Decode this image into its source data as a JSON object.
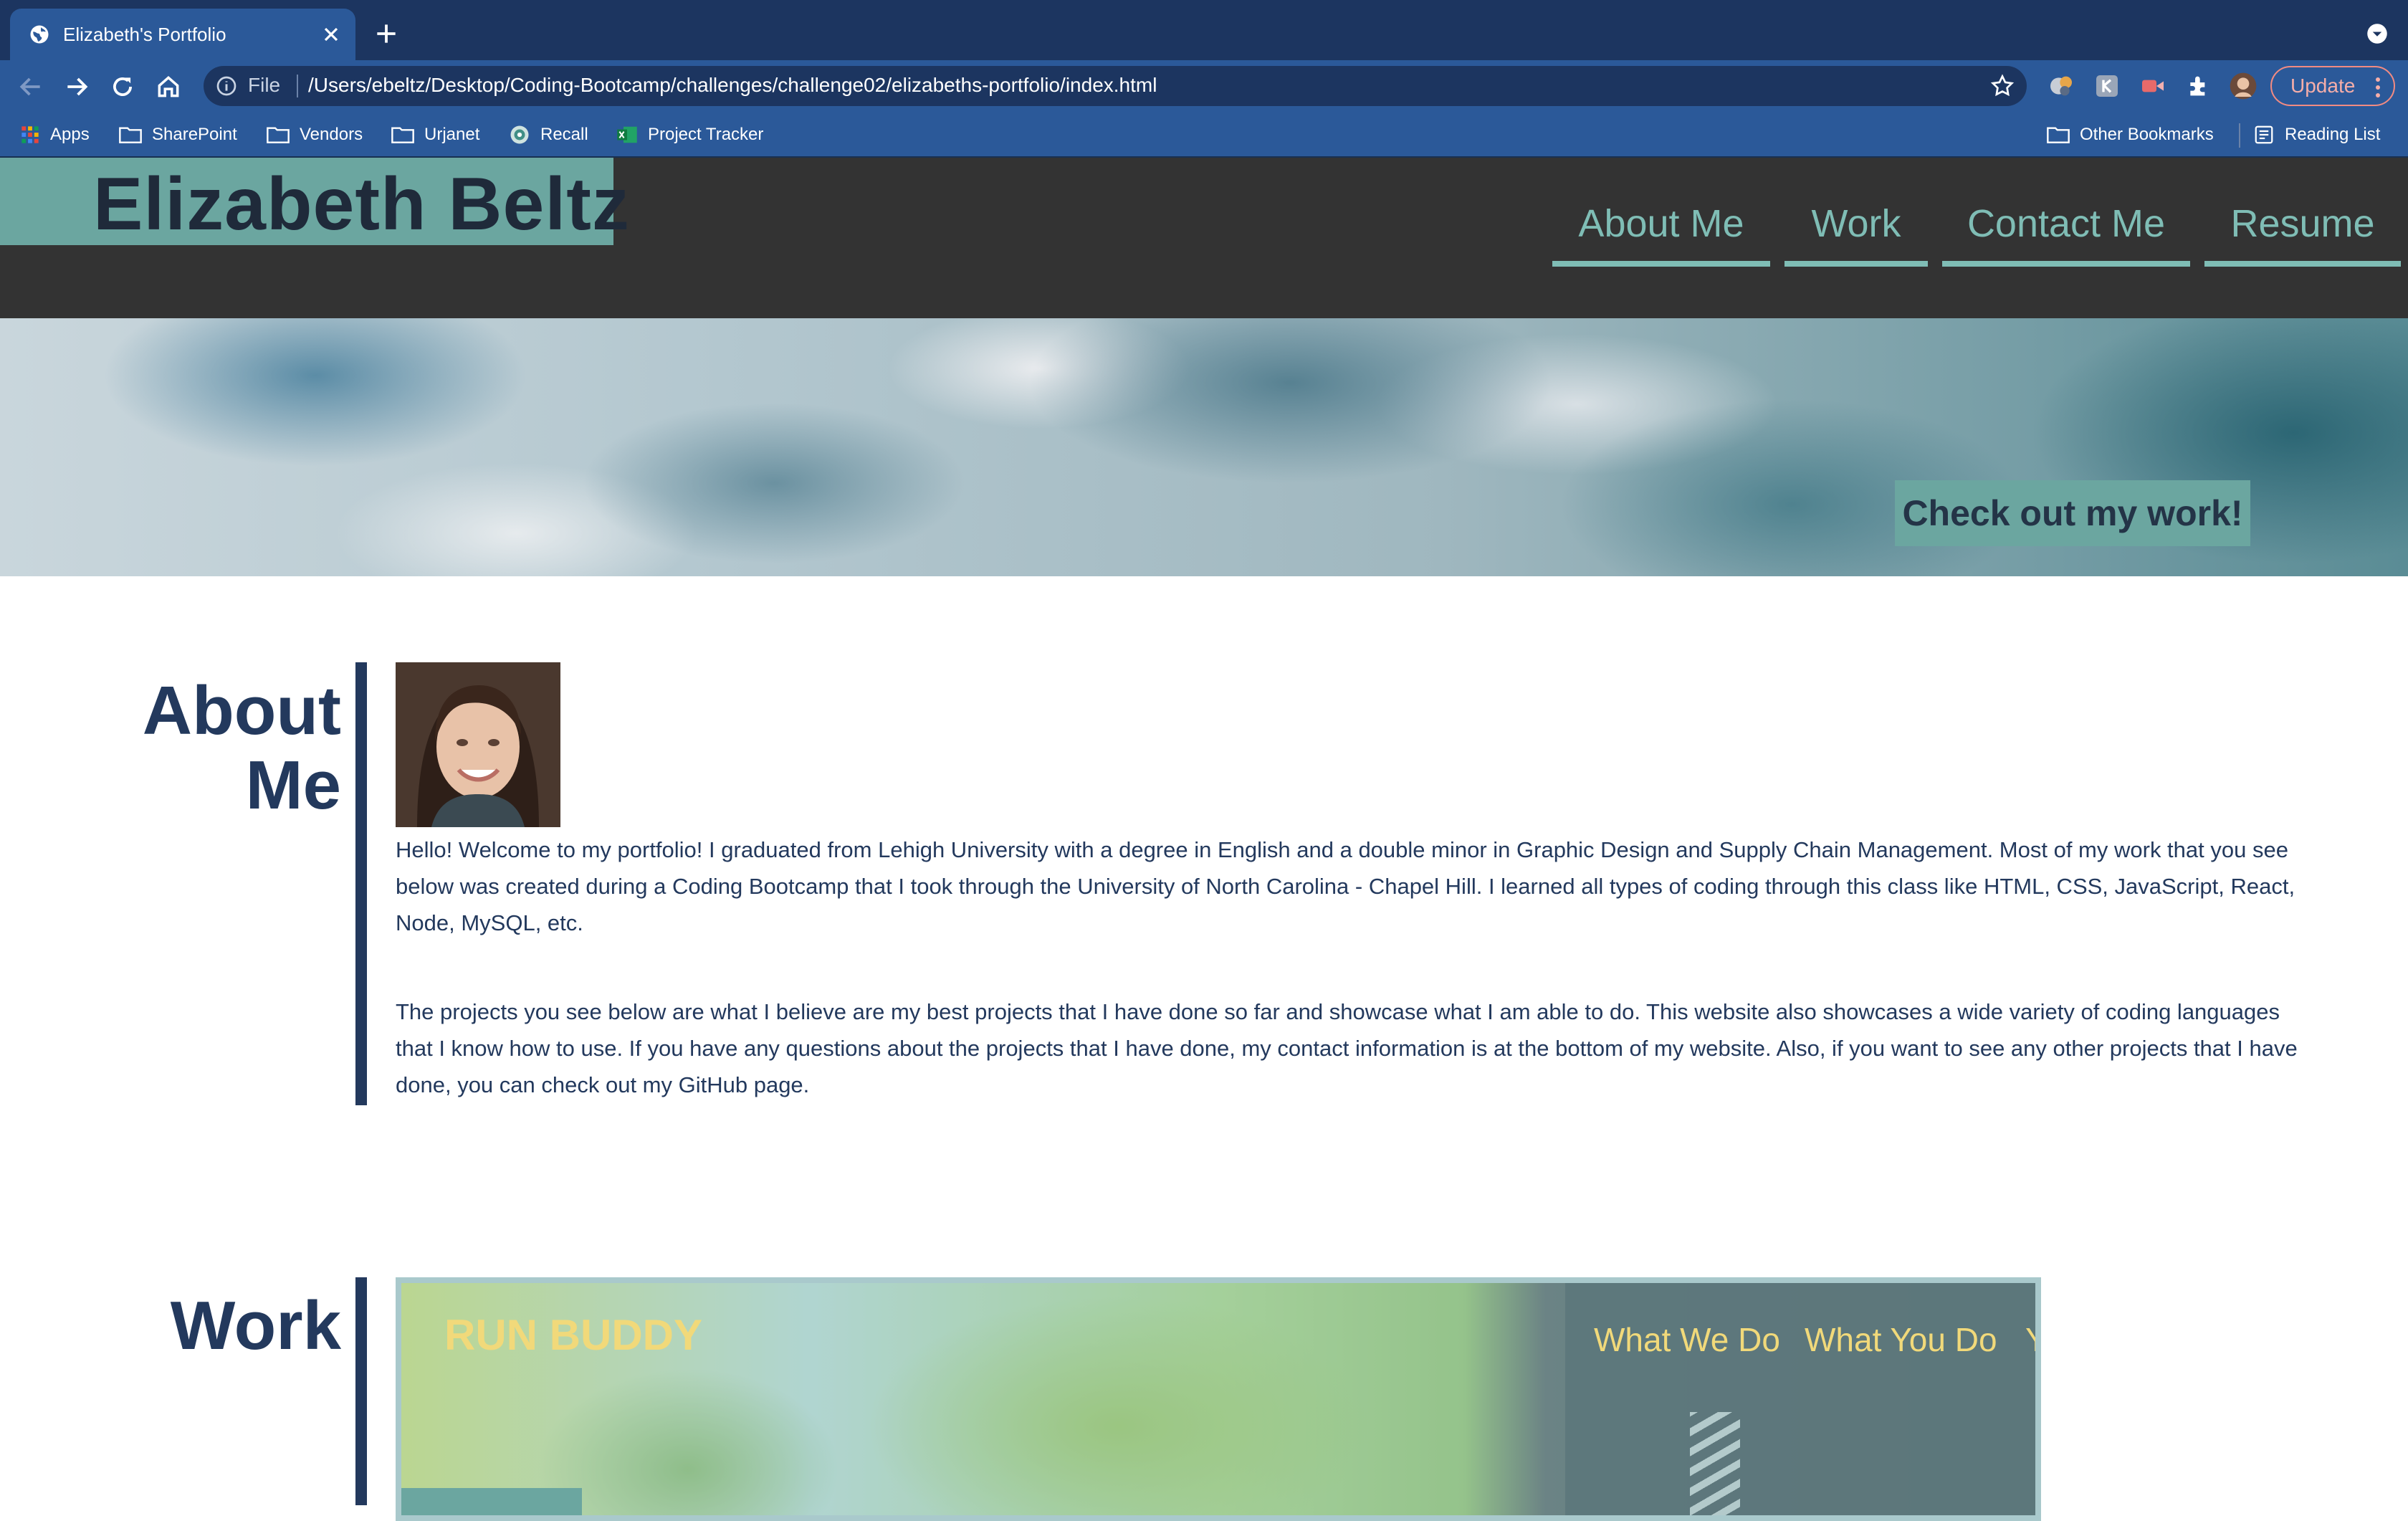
{
  "browser": {
    "tab_title": "Elizabeth's Portfolio",
    "url_scheme": "File",
    "url": "/Users/ebeltz/Desktop/Coding-Bootcamp/challenges/challenge02/elizabeths-portfolio/index.html",
    "update_label": "Update",
    "bookmarks": [
      {
        "label": "Apps",
        "icon": "apps-grid-icon"
      },
      {
        "label": "SharePoint",
        "icon": "folder-icon"
      },
      {
        "label": "Vendors",
        "icon": "folder-icon"
      },
      {
        "label": "Urjanet",
        "icon": "folder-icon"
      },
      {
        "label": "Recall",
        "icon": "recall-icon"
      },
      {
        "label": "Project Tracker",
        "icon": "excel-icon"
      }
    ],
    "other_bookmarks": "Other Bookmarks",
    "reading_list": "Reading List"
  },
  "site": {
    "name": "Elizabeth Beltz",
    "nav": [
      "About Me",
      "Work",
      "Contact Me",
      "Resume"
    ],
    "hero_cta": "Check out my work!",
    "about": {
      "title": "About Me",
      "paragraph1": "Hello! Welcome to my portfolio! I graduated from Lehigh University with a degree in English and a double minor in Graphic Design and Supply Chain Management. Most of my work that you see below was created during a Coding Bootcamp that I took through the University of North Carolina - Chapel Hill. I learned all types of coding through this class like HTML, CSS, JavaScript, React, Node, MySQL, etc.",
      "paragraph2": "The projects you see below are what I believe are my best projects that I have done so far and showcase what I am able to do. This website also showcases a wide variety of coding languages that I know how to use. If you have any questions about the projects that I have done, my contact information is at the bottom of my website. Also, if you want to see any other projects that I have done, you can check out my GitHub page."
    },
    "work": {
      "title": "Work",
      "project": {
        "logo": "RUN BUDDY",
        "nav": [
          "What We Do",
          "What You Do",
          "Y"
        ]
      }
    }
  },
  "colors": {
    "chrome_dark": "#1c3560",
    "chrome": "#2b5999",
    "header_bg": "#333333",
    "accent_teal": "#6ba6a0",
    "nav_teal": "#7fbdb5",
    "navy_text": "#23395d",
    "project_yellow": "#f1d97a"
  }
}
